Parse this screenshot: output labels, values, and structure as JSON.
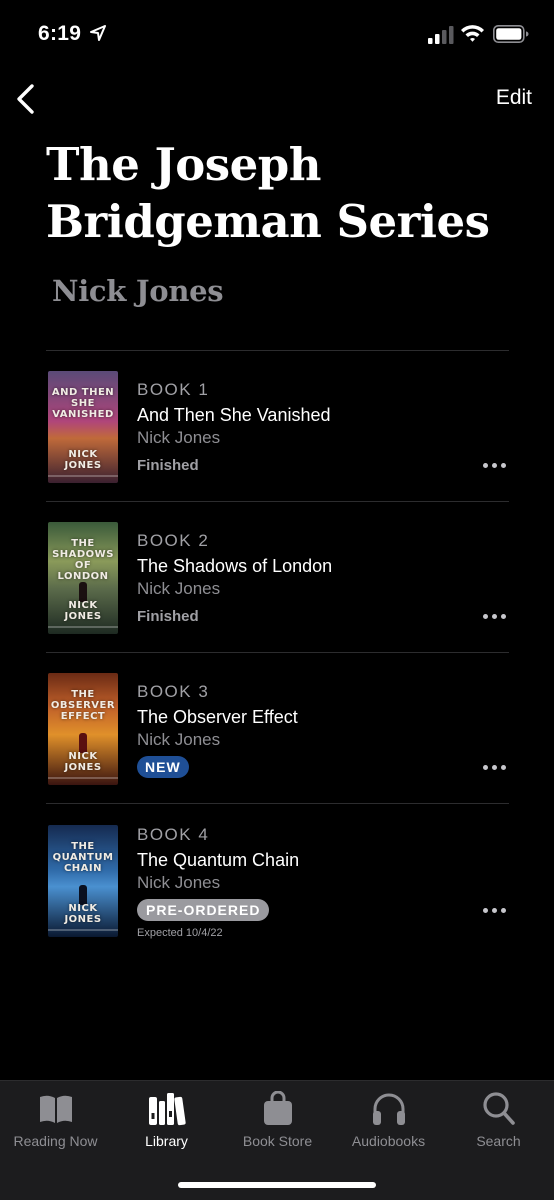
{
  "status_bar": {
    "time": "6:19"
  },
  "nav": {
    "edit_label": "Edit"
  },
  "series": {
    "title": "The Joseph Bridgeman Series",
    "author": "Nick Jones"
  },
  "books": [
    {
      "number": "BOOK 1",
      "title": "And Then She Vanished",
      "author": "Nick Jones",
      "status": "Finished",
      "cover": {
        "title_lines": "AND THEN SHE VANISHED",
        "author_lines": "NICK JONES",
        "colors": [
          "#5a4a78",
          "#b0457a",
          "#3a2030"
        ]
      }
    },
    {
      "number": "BOOK 2",
      "title": "The Shadows of London",
      "author": "Nick Jones",
      "status": "Finished",
      "cover": {
        "title_lines": "THE SHADOWS OF LONDON",
        "author_lines": "NICK JONES",
        "colors": [
          "#3f5a3a",
          "#7f8a5a",
          "#1e2a22"
        ]
      }
    },
    {
      "number": "BOOK 3",
      "title": "The Observer Effect",
      "author": "Nick Jones",
      "badge": "NEW",
      "cover": {
        "title_lines": "THE OBSERVER EFFECT",
        "author_lines": "NICK JONES",
        "colors": [
          "#8a3a1a",
          "#d0702a",
          "#3a1410"
        ]
      }
    },
    {
      "number": "BOOK 4",
      "title": "The Quantum Chain",
      "author": "Nick Jones",
      "badge": "PRE-ORDERED",
      "expected": "Expected 10/4/22",
      "cover": {
        "title_lines": "THE QUANTUM CHAIN",
        "author_lines": "NICK JONES",
        "colors": [
          "#1a3a6a",
          "#3a78b8",
          "#0a1830"
        ]
      }
    }
  ],
  "tabs": [
    {
      "label": "Reading Now",
      "icon": "book-open-icon",
      "active": false
    },
    {
      "label": "Library",
      "icon": "library-icon",
      "active": true
    },
    {
      "label": "Book Store",
      "icon": "shopping-bag-icon",
      "active": false
    },
    {
      "label": "Audiobooks",
      "icon": "headphones-icon",
      "active": false
    },
    {
      "label": "Search",
      "icon": "search-icon",
      "active": false
    }
  ],
  "colors": {
    "background": "#000000",
    "new_badge": "#1f4f96",
    "preorder_badge": "#9a9a9f",
    "tab_bar": "#1c1c1e"
  }
}
